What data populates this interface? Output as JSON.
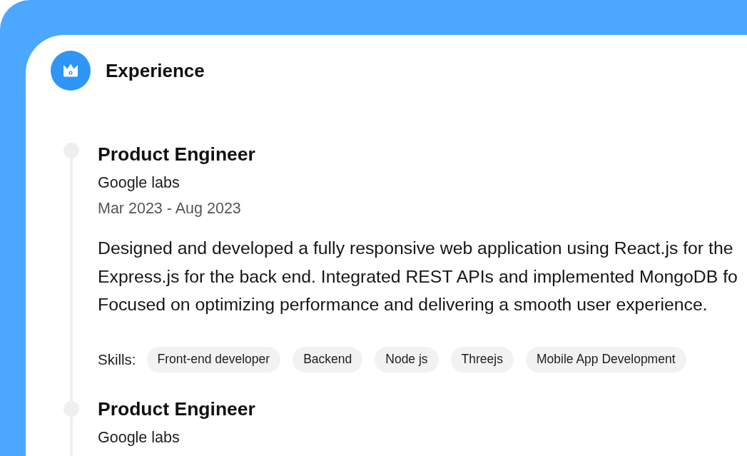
{
  "section": {
    "title": "Experience"
  },
  "entries": [
    {
      "title": "Product Engineer",
      "company": "Google labs",
      "dates": "Mar 2023 - Aug 2023",
      "description_lines": [
        "Designed and developed a fully responsive web application using React.js for the",
        "Express.js for the back end. Integrated REST APIs and implemented MongoDB fo",
        "Focused on optimizing performance and delivering a smooth user experience."
      ],
      "skills_label": "Skills:",
      "skills": [
        "Front-end developer",
        "Backend",
        "Node js",
        "Threejs",
        "Mobile App Development"
      ]
    },
    {
      "title": "Product Engineer",
      "company": "Google labs"
    }
  ]
}
